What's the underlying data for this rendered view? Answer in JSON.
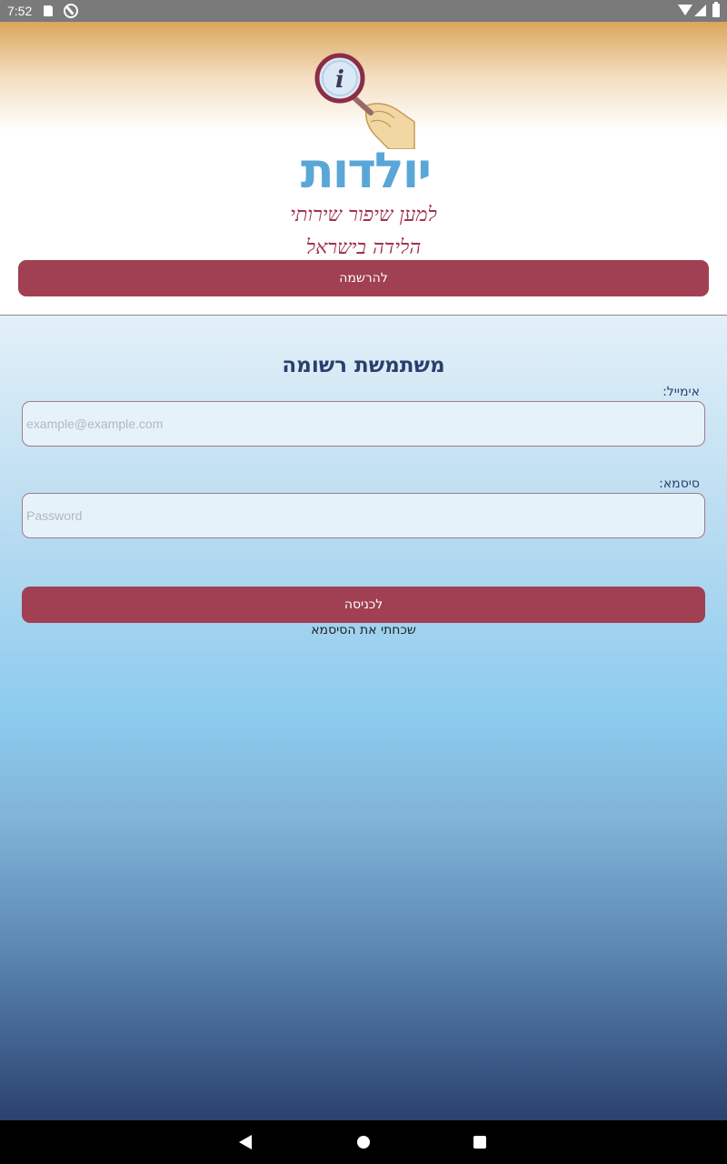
{
  "status_bar": {
    "time": "7:52"
  },
  "logo": {
    "wordmark": "יולדות",
    "tagline_line1": "למען שיפור שירותי",
    "tagline_line2": "הלידה בישראל",
    "colors": {
      "wordmark": "#5aa6d6",
      "tagline": "#a0334d",
      "lens_ring": "#8b2d45"
    }
  },
  "register": {
    "label": "להרשמה"
  },
  "login": {
    "title": "משתמשת רשומה",
    "email_label": "אימייל:",
    "email_placeholder": "example@example.com",
    "email_value": "",
    "password_label": "סיסמא:",
    "password_placeholder": "Password",
    "password_value": "",
    "submit_label": "לכניסה",
    "forgot_label": "שכחתי את הסיסמא"
  },
  "theme": {
    "accent": "#a04052",
    "heading": "#2a3f6c"
  },
  "nav_bar": {
    "icons": [
      "back-icon",
      "home-icon",
      "recents-icon"
    ]
  }
}
